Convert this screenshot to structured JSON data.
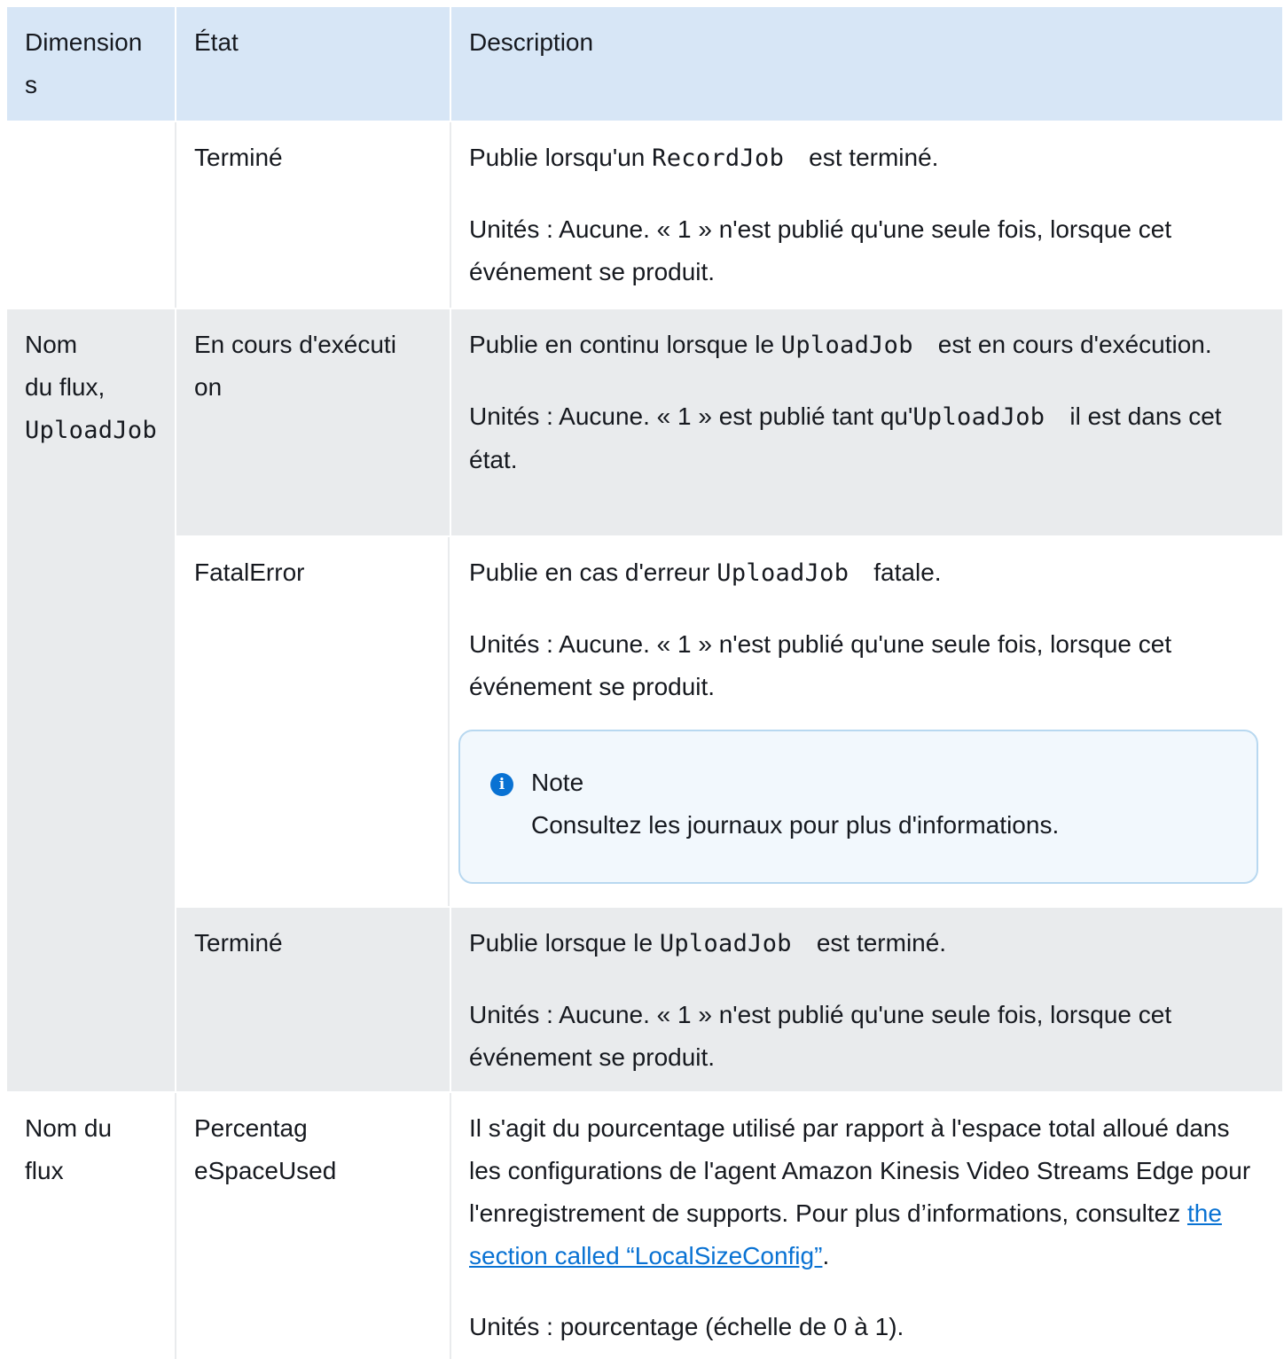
{
  "header": {
    "col1": "Dimension",
    "col1_wrap": "s",
    "col2": "État",
    "col3": "Description"
  },
  "rows": [
    {
      "dimension": "",
      "state": "Terminé",
      "desc_pre": "Publie lorsqu'un ",
      "desc_code": "RecordJob",
      "desc_post": "est terminé.",
      "units": "Unités : Aucune. « 1 » n'est publié qu'une seule fois, lorsque cet événement se produit."
    },
    {
      "dimension_line1": "Nom",
      "dimension_line2": "du flux,",
      "dimension_code": "UploadJob",
      "state_line1": "En cours d'exécuti",
      "state_line2": "on",
      "desc_pre": "Publie en continu lorsque le ",
      "desc_code": "UploadJob",
      "desc_post": "est en cours d'exécution.",
      "units_pre": "Unités : Aucune. « 1 » est publié tant qu'",
      "units_code": "UploadJob",
      "units_post": "il est dans cet état."
    },
    {
      "state": "FatalError",
      "desc_pre": "Publie en cas d'erreur ",
      "desc_code": "UploadJob",
      "desc_post": "fatale.",
      "units": "Unités : Aucune. « 1 » n'est publié qu'une seule fois, lorsque cet événement se produit.",
      "note_title": "Note",
      "note_text": "Consultez les journaux pour plus d'informations."
    },
    {
      "state": "Terminé",
      "desc_pre": "Publie lorsque le ",
      "desc_code": "UploadJob",
      "desc_post": "est terminé.",
      "units": "Unités : Aucune. « 1 » n'est publié qu'une seule fois, lorsque cet événement se produit."
    },
    {
      "dimension_line1": "Nom du",
      "dimension_line2": "flux",
      "state_line1": "Percentag",
      "state_line2": "eSpaceUsed",
      "desc": "Il s'agit du pourcentage utilisé par rapport à l'espace total alloué dans les configurations de l'agent Amazon Kinesis Video Streams Edge pour l'enregistrement de supports. Pour plus d’informations, consultez ",
      "link": "the section called “LocalSizeConfig”",
      "desc_end": ".",
      "units": "Unités : pourcentage (échelle de 0 à 1)."
    }
  ],
  "colors": {
    "header_bg": "#d7e6f6",
    "grey_bg": "#e9ebed",
    "link": "#0972d3",
    "note_border": "#b8d8f0",
    "note_bg": "#f2f8fd",
    "info_icon": "#0972d3"
  },
  "icons": [
    "info-icon"
  ]
}
